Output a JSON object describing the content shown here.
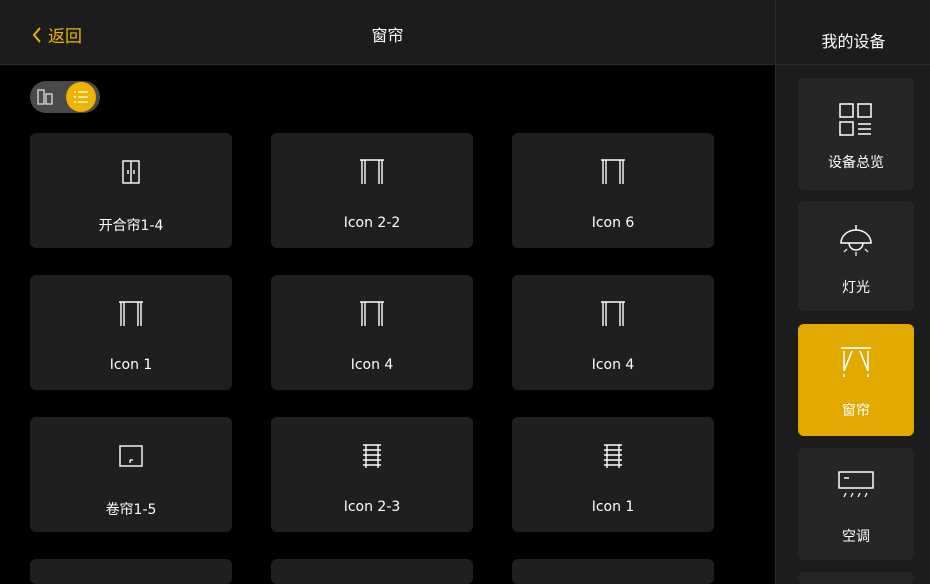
{
  "header": {
    "back_label": "返回",
    "title": "窗帘"
  },
  "sidebar": {
    "title": "我的设备",
    "items": [
      {
        "label": "设备总览",
        "icon": "overview-icon",
        "active": false
      },
      {
        "label": "灯光",
        "icon": "lamp-icon",
        "active": false
      },
      {
        "label": "窗帘",
        "icon": "curtain-icon",
        "active": true
      },
      {
        "label": "空调",
        "icon": "aircon-icon",
        "active": false
      }
    ]
  },
  "view_toggle": {
    "options": [
      "grid-view-icon",
      "list-view-icon"
    ],
    "selected": "list-view-icon"
  },
  "devices": [
    {
      "label": "开合帘1-4",
      "icon": "split-curtain-icon"
    },
    {
      "label": "Icon 2-2",
      "icon": "curtain-icon"
    },
    {
      "label": "Icon 6",
      "icon": "curtain-icon"
    },
    {
      "label": "Icon 1",
      "icon": "curtain-icon"
    },
    {
      "label": "Icon 4",
      "icon": "curtain-icon"
    },
    {
      "label": "Icon 4",
      "icon": "curtain-icon"
    },
    {
      "label": "卷帘1-5",
      "icon": "roller-blind-icon"
    },
    {
      "label": "Icon 2-3",
      "icon": "venetian-blind-icon"
    },
    {
      "label": "Icon 1",
      "icon": "venetian-blind-icon"
    }
  ],
  "colors": {
    "accent": "#f0b400",
    "active_tile": "#e2a900",
    "card": "#1f1f1f",
    "panel": "#1c1c1c"
  }
}
